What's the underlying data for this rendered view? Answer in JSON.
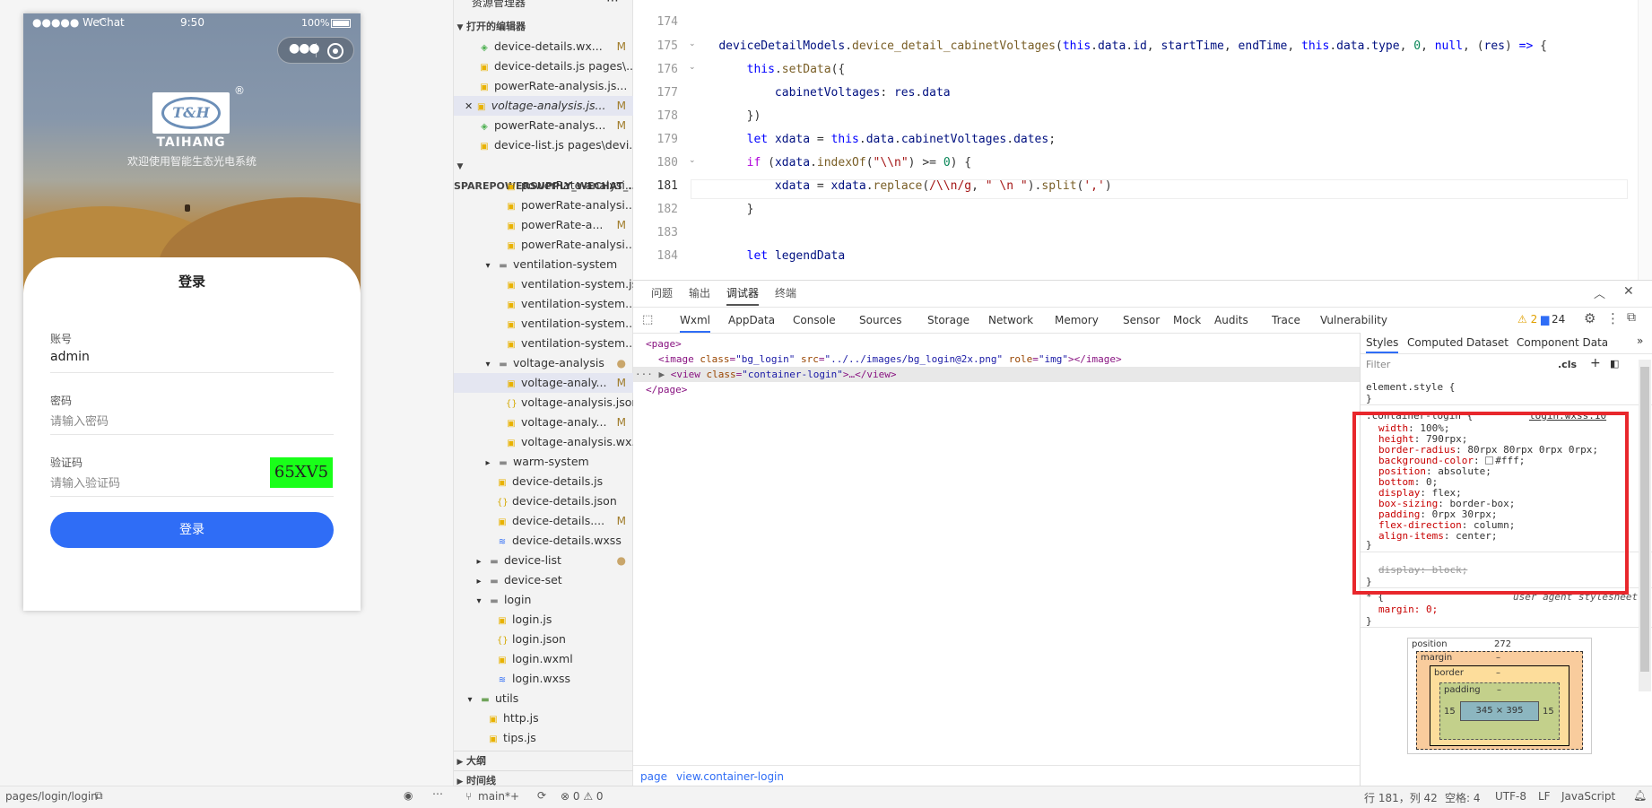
{
  "simulator": {
    "status_left": "●●●●● WeChat",
    "status_time": "9:50",
    "status_battery": "100%",
    "logo_mark": "T&H",
    "logo_name": "TAIHANG",
    "welcome": "欢迎使用智能生态光电系统",
    "card_title": "登录",
    "account_label": "账号",
    "account_value": "admin",
    "password_label": "密码",
    "password_placeholder": "请输入密码",
    "captcha_label": "验证码",
    "captcha_placeholder": "请输入验证码",
    "captcha_text": "65XV5",
    "login_button": "登录",
    "page_path": "pages/login/login"
  },
  "explorer": {
    "header": "资源管理器",
    "open_editors": "打开的编辑器",
    "project": "SPAREPOWERSUPPLY_WECHAT_...",
    "open_files": [
      {
        "name": "device-details.wx...",
        "badge": "M",
        "icon": "wxml-icon"
      },
      {
        "name": "device-details.js pages\\...",
        "badge": "",
        "icon": "js-icon"
      },
      {
        "name": "powerRate-analysis.js...",
        "badge": "",
        "icon": "js-icon"
      },
      {
        "name": "voltage-analysis.js...",
        "badge": "M",
        "icon": "js-icon"
      },
      {
        "name": "powerRate-analys...",
        "badge": "M",
        "icon": "wxml-icon"
      },
      {
        "name": "device-list.js pages\\devi...",
        "badge": "",
        "icon": "js-icon"
      }
    ],
    "tree": [
      {
        "name": "powerRate-analysi...",
        "badge": "",
        "indent": 3
      },
      {
        "name": "powerRate-analysi...",
        "badge": "",
        "indent": 3
      },
      {
        "name": "powerRate-a...",
        "badge": "M",
        "indent": 3
      },
      {
        "name": "powerRate-analysi...",
        "badge": "",
        "indent": 3
      },
      {
        "name": "ventilation-system",
        "badge": "",
        "indent": 2
      },
      {
        "name": "ventilation-system.js",
        "badge": "",
        "indent": 3
      },
      {
        "name": "ventilation-system....",
        "badge": "",
        "indent": 3
      },
      {
        "name": "ventilation-system....",
        "badge": "",
        "indent": 3
      },
      {
        "name": "ventilation-system....",
        "badge": "",
        "indent": 3
      },
      {
        "name": "voltage-analysis",
        "badge": "●",
        "indent": 2
      },
      {
        "name": "voltage-analy...",
        "badge": "M",
        "indent": 3
      },
      {
        "name": "voltage-analysis.json",
        "badge": "",
        "indent": 3
      },
      {
        "name": "voltage-analy...",
        "badge": "M",
        "indent": 3
      },
      {
        "name": "voltage-analysis.wx...",
        "badge": "",
        "indent": 3
      },
      {
        "name": "warm-system",
        "badge": "",
        "indent": 2
      },
      {
        "name": "device-details.js",
        "badge": "",
        "indent": 2
      },
      {
        "name": "device-details.json",
        "badge": "",
        "indent": 2
      },
      {
        "name": "device-details....",
        "badge": "M",
        "indent": 2
      },
      {
        "name": "device-details.wxss",
        "badge": "",
        "indent": 2
      },
      {
        "name": "device-list",
        "badge": "●",
        "indent": 1
      },
      {
        "name": "device-set",
        "badge": "",
        "indent": 1
      },
      {
        "name": "login",
        "badge": "",
        "indent": 1
      },
      {
        "name": "login.js",
        "badge": "",
        "indent": 2
      },
      {
        "name": "login.json",
        "badge": "",
        "indent": 2
      },
      {
        "name": "login.wxml",
        "badge": "",
        "indent": 2
      },
      {
        "name": "login.wxss",
        "badge": "",
        "indent": 2
      },
      {
        "name": "utils",
        "badge": "",
        "indent": 0
      },
      {
        "name": "http.js",
        "badge": "",
        "indent": 1
      },
      {
        "name": "tips.js",
        "badge": "",
        "indent": 1
      }
    ],
    "outline": "大纲",
    "timeline": "时间线"
  },
  "editor": {
    "lines": [
      {
        "n": "174"
      },
      {
        "n": "175"
      },
      {
        "n": "176"
      },
      {
        "n": "177"
      },
      {
        "n": "178"
      },
      {
        "n": "179"
      },
      {
        "n": "180"
      },
      {
        "n": "181"
      },
      {
        "n": "182"
      },
      {
        "n": "183"
      },
      {
        "n": "184"
      }
    ]
  },
  "devtools": {
    "top_tabs": [
      "问题",
      "输出",
      "调试器",
      "终端"
    ],
    "tabs": [
      "Wxml",
      "AppData",
      "Console",
      "Sources",
      "Storage",
      "Network",
      "Memory",
      "Sensor",
      "Mock",
      "Audits",
      "Trace",
      "Vulnerability"
    ],
    "warnings": "⚠ 2",
    "messages": "24",
    "wxml_page_open": "<page>",
    "wxml_image": "<image class=\"bg_login\" src=\"../../images/bg_login@2x.png\" role=\"img\"></image>",
    "wxml_view": "<view class=\"container-login\">…</view>",
    "wxml_page_close": "</page>",
    "styles_tabs": [
      "Styles",
      "Computed",
      "Dataset",
      "Component Data"
    ],
    "filter_placeholder": "Filter",
    "cls": ".cls",
    "element_style": "element.style {",
    "rule_selector": ".container-login {",
    "rule_source": "login.wxss:10",
    "declarations": [
      {
        "p": "width",
        "v": "100%;"
      },
      {
        "p": "height",
        "v": "790rpx;"
      },
      {
        "p": "border-radius",
        "v": "80rpx 80rpx 0rpx 0rpx;"
      },
      {
        "p": "background-color",
        "v": "#fff;"
      },
      {
        "p": "position",
        "v": "absolute;"
      },
      {
        "p": "bottom",
        "v": "0;"
      },
      {
        "p": "display",
        "v": "flex;"
      },
      {
        "p": "box-sizing",
        "v": "border-box;"
      },
      {
        "p": "padding",
        "v": "0rpx 30rpx;"
      },
      {
        "p": "flex-direction",
        "v": "column;"
      },
      {
        "p": "align-items",
        "v": "center;"
      }
    ],
    "overridden": "display: block;",
    "ua_selector": "* {",
    "ua_source": "user agent stylesheet",
    "ua_decl": "margin: 0;",
    "box_position": "position",
    "box_position_val": "272",
    "box_margin": "margin",
    "box_border": "border",
    "box_padding": "padding",
    "box_content": "345 × 395",
    "box_pad_left": "15",
    "box_pad_right": "15",
    "breadcrumb_page": "page",
    "breadcrumb_view": "view.container-login"
  },
  "statusbar": {
    "branch": "main*+",
    "errors": "⊗ 0 ⚠ 0",
    "cursor": "行 181，列 42",
    "spaces": "空格: 4",
    "encoding": "UTF-8",
    "eol": "LF",
    "language": "JavaScript"
  }
}
